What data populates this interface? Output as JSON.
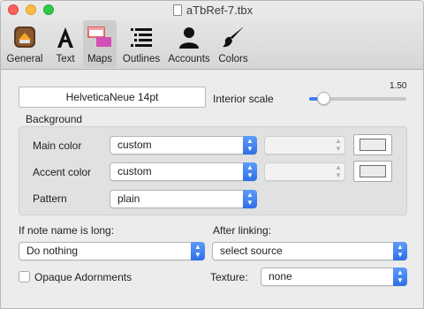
{
  "window": {
    "title": "aTbRef-7.tbx"
  },
  "toolbar": {
    "items": [
      {
        "label": "General",
        "icon": "app-icon"
      },
      {
        "label": "Text",
        "icon": "letter-a-icon"
      },
      {
        "label": "Maps",
        "icon": "maps-icon",
        "selected": true
      },
      {
        "label": "Outlines",
        "icon": "outline-list-icon"
      },
      {
        "label": "Accounts",
        "icon": "person-icon"
      },
      {
        "label": "Colors",
        "icon": "brush-icon"
      }
    ]
  },
  "maps": {
    "font_button": "HelveticaNeue 14pt",
    "interior_scale_label": "Interior scale",
    "interior_scale_value": "1.50",
    "interior_scale_fraction": 0.15,
    "background": {
      "title": "Background",
      "main_color_label": "Main color",
      "main_color_value": "custom",
      "accent_color_label": "Accent color",
      "accent_color_value": "custom",
      "pattern_label": "Pattern",
      "pattern_value": "plain"
    },
    "long_name_label": "If note name is long:",
    "long_name_value": "Do nothing",
    "after_linking_label": "After linking:",
    "after_linking_value": "select source",
    "opaque_adornments_label": "Opaque Adornments",
    "opaque_adornments_checked": false,
    "texture_label": "Texture:",
    "texture_value": "none"
  },
  "colors": {
    "accent": "#3b7ff5",
    "swatch": "#ececec"
  }
}
